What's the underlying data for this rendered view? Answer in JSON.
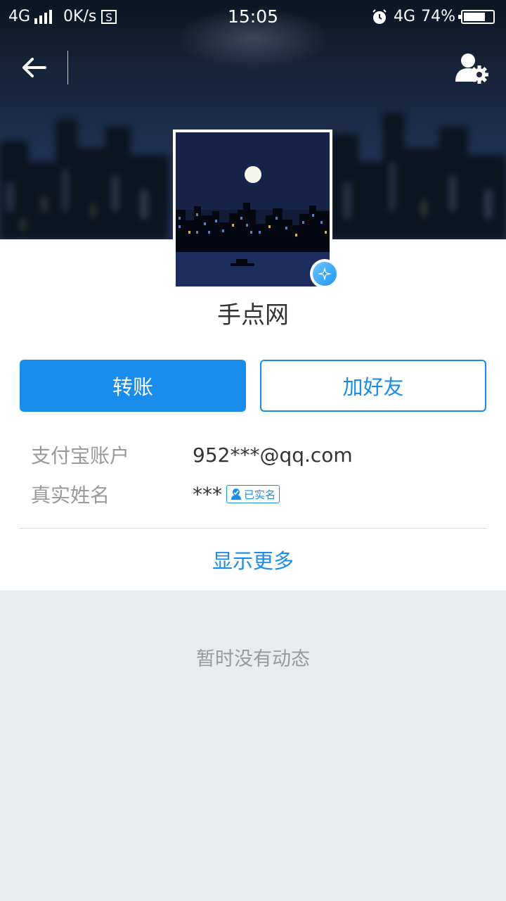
{
  "status_bar": {
    "network_left": "4G",
    "speed": "0K/s",
    "time": "15:05",
    "network_right": "4G",
    "battery": "74%",
    "battery_level": 0.74
  },
  "profile": {
    "name": "手点网"
  },
  "actions": {
    "transfer_label": "转账",
    "add_friend_label": "加好友"
  },
  "info": {
    "account_label": "支付宝账户",
    "account_value": "952***@qq.com",
    "realname_label": "真实姓名",
    "realname_value": "***",
    "verified_tag": "已实名"
  },
  "show_more_label": "显示更多",
  "empty_state": "暂时没有动态",
  "colors": {
    "accent": "#1a8cec",
    "label_gray": "#999999",
    "page_bg": "#e9ecee"
  },
  "icons": [
    "back-arrow-icon",
    "user-settings-icon",
    "verified-star-icon",
    "realname-person-icon",
    "alarm-icon",
    "screenshot-s-icon"
  ]
}
